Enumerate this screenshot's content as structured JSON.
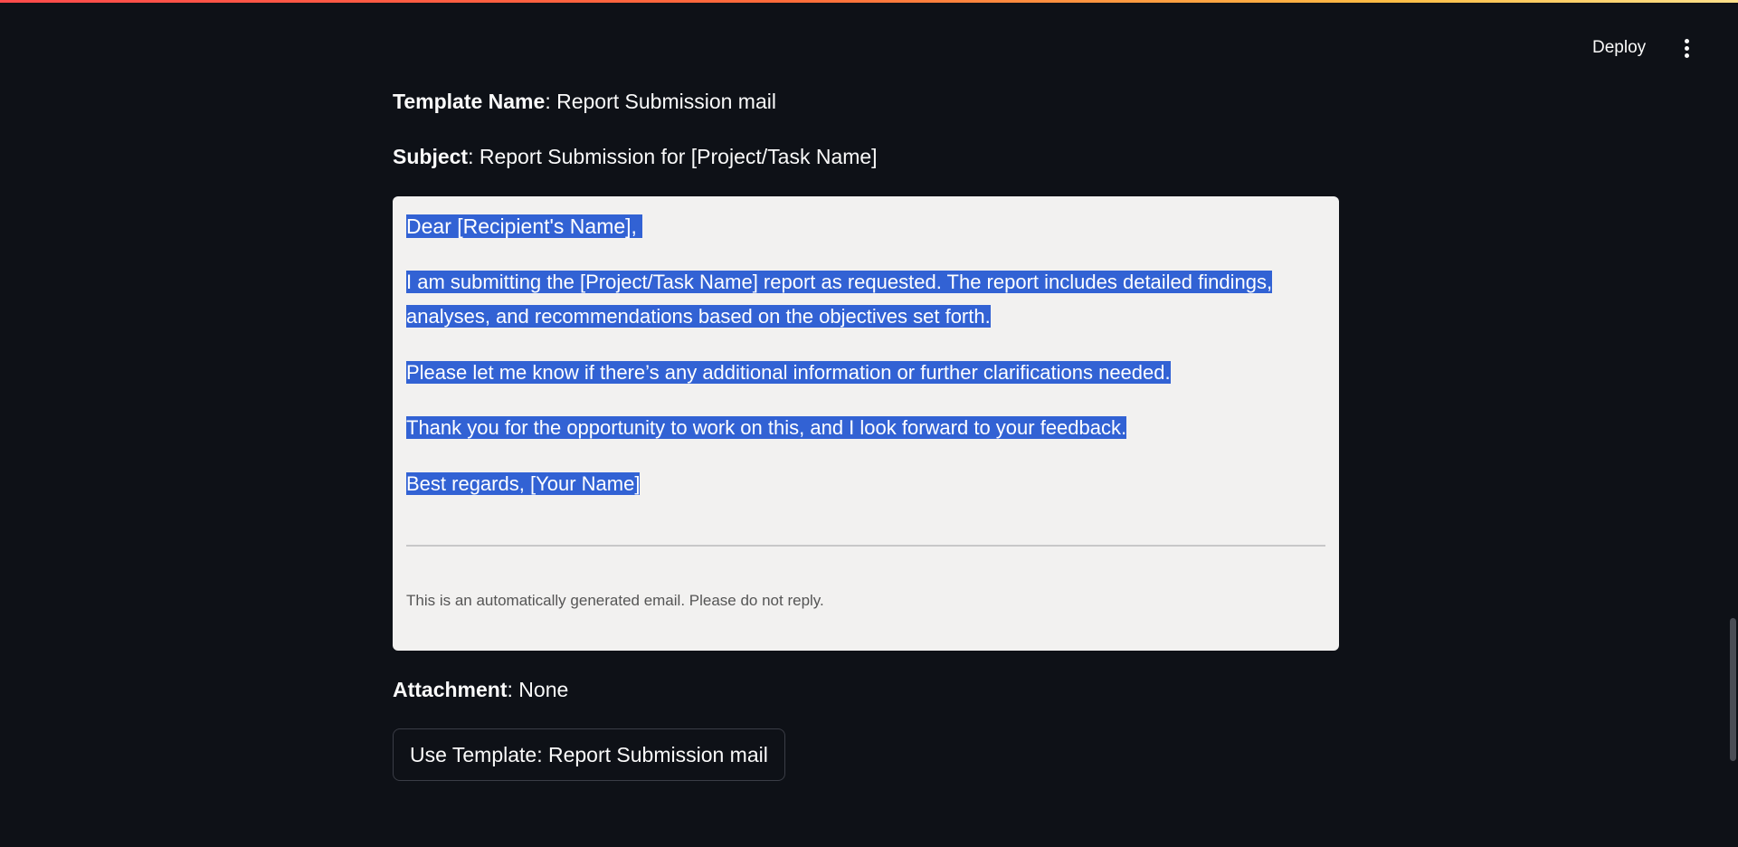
{
  "header": {
    "deploy_label": "Deploy",
    "menu_icon": "vertical-ellipsis-icon"
  },
  "template": {
    "name_label": "Template Name",
    "name_value": "Report Submission mail",
    "subject_label": "Subject",
    "subject_value": "Report Submission for [Project/Task Name]",
    "attachment_label": "Attachment",
    "attachment_value": "None"
  },
  "email": {
    "greeting": "Dear [Recipient's Name],",
    "paragraph1_line1": "I am submitting the [Project/Task Name] report as requested. The report includes detailed findings,",
    "paragraph1_line2": "analyses, and recommendations based on the objectives set forth.",
    "paragraph2": "Please let me know if there’s any additional information or further clarifications needed.",
    "paragraph3": "Thank you for the opportunity to work on this, and I look forward to your feedback.",
    "signoff": "Best regards, [Your Name]",
    "footer_note": "This is an automatically generated email. Please do not reply."
  },
  "actions": {
    "use_template_label": "Use Template: Report Submission mail"
  },
  "colors": {
    "background": "#0e1117",
    "preview_background": "#f2f1f0",
    "selection": "#3262d4",
    "text": "#fafafa"
  }
}
